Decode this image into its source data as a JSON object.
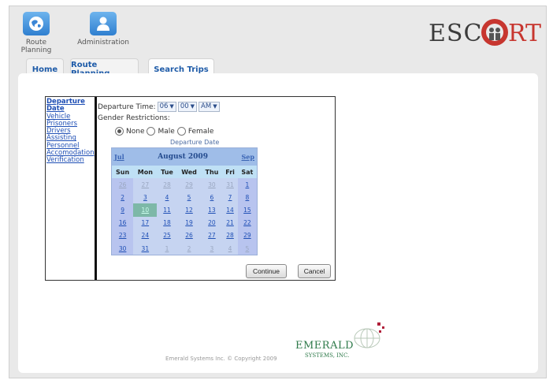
{
  "header": {
    "apps": [
      {
        "label": "Route Planning",
        "icon": "globe-icon"
      },
      {
        "label": "Administration",
        "icon": "person-icon"
      }
    ],
    "logo_text": "ESCORT",
    "logo_color": "#c0302a"
  },
  "tabs": [
    {
      "label": "Home"
    },
    {
      "label": "Route Planning"
    },
    {
      "label": "Search Trips"
    }
  ],
  "steps": [
    {
      "label": "Departure"
    },
    {
      "label": "Date"
    },
    {
      "label": "Vehicle"
    },
    {
      "label": "Prisoners"
    },
    {
      "label": "Drivers"
    },
    {
      "label": "Assisting"
    },
    {
      "label": "Personnel"
    },
    {
      "label": "Accomodation"
    },
    {
      "label": "Verification"
    }
  ],
  "form": {
    "departure_time_label": "Departure Time:",
    "hour": "06",
    "minute": "00",
    "ampm": "AM",
    "gender_label": "Gender Restrictions:",
    "gender_options": [
      "None",
      "Male",
      "Female"
    ],
    "gender_selected": "None",
    "departure_date_label": "Departure Date"
  },
  "calendar": {
    "prev": "Jul",
    "title": "August 2009",
    "next": "Sep",
    "days": [
      "Sun",
      "Mon",
      "Tue",
      "Wed",
      "Thu",
      "Fri",
      "Sat"
    ],
    "weeks": [
      [
        "26",
        "27",
        "28",
        "29",
        "30",
        "31",
        "1"
      ],
      [
        "2",
        "3",
        "4",
        "5",
        "6",
        "7",
        "8"
      ],
      [
        "9",
        "10",
        "11",
        "12",
        "13",
        "14",
        "15"
      ],
      [
        "16",
        "17",
        "18",
        "19",
        "20",
        "21",
        "22"
      ],
      [
        "23",
        "24",
        "25",
        "26",
        "27",
        "28",
        "29"
      ],
      [
        "30",
        "31",
        "1",
        "2",
        "3",
        "4",
        "5"
      ]
    ],
    "selected_day": "10"
  },
  "buttons": {
    "continue": "Continue",
    "cancel": "Cancel"
  },
  "footer": {
    "copyright": "Emerald Systems Inc. © Copyright 2009",
    "brand_line1": "EMERALD",
    "brand_line2": "SYSTEMS, INC."
  }
}
